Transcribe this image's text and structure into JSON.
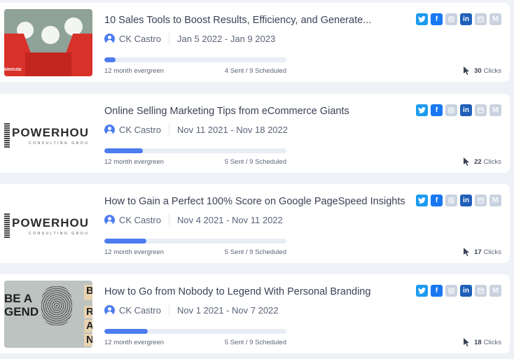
{
  "posts": [
    {
      "title": "10 Sales Tools to Boost Results, Efficiency, and Generate...",
      "author": "CK Castro",
      "date_range": "Jan 5 2022 - Jan 9 2023",
      "progress_percent": 6,
      "evergreen": "12 month evergreen",
      "scheduled": "4 Sent / 9 Scheduled",
      "clicks": "30",
      "clicks_label": "Clicks",
      "thumbnail": "toolbox-image"
    },
    {
      "title": "Online Selling Marketing Tips from eCommerce Giants",
      "author": "CK Castro",
      "date_range": "Nov 11 2021 - Nov 18 2022",
      "progress_percent": 21,
      "evergreen": "12 month evergreen",
      "scheduled": "5 Sent / 9 Scheduled",
      "clicks": "22",
      "clicks_label": "Clicks",
      "thumbnail": "powerhouse-logo"
    },
    {
      "title": "How to Gain a Perfect 100% Score on Google PageSpeed Insights",
      "author": "CK Castro",
      "date_range": "Nov 4 2021 - Nov 11 2022",
      "progress_percent": 23,
      "evergreen": "12 month evergreen",
      "scheduled": "5 Sent / 9 Scheduled",
      "clicks": "17",
      "clicks_label": "Clicks",
      "thumbnail": "powerhouse-logo"
    },
    {
      "title": "How to Go from Nobody to Legend With Personal Branding",
      "author": "CK Castro",
      "date_range": "Nov 1 2021 - Nov 7 2022",
      "progress_percent": 24,
      "evergreen": "12 month evergreen",
      "scheduled": "5 Sent / 9 Scheduled",
      "clicks": "18",
      "clicks_label": "Clicks",
      "thumbnail": "legend-image"
    }
  ],
  "thumb_text": {
    "powerhouse": "POWERHOU",
    "consulting": "CONSULTING GROU",
    "legend1": "BE A",
    "legend2": "GEND",
    "blocks": [
      "B",
      "R",
      "A",
      "N"
    ],
    "toolbox_caption": "ERHOUSE"
  },
  "social_icons": [
    "twitter-icon",
    "facebook-icon",
    "instagram-icon",
    "linkedin-icon",
    "news-icon",
    "medium-icon"
  ],
  "colors": {
    "accent": "#4d7cf0",
    "twitter": "#1d9bf0",
    "facebook": "#1877f2",
    "linkedin": "#1f5fb8",
    "inactive": "#c9d3df"
  }
}
